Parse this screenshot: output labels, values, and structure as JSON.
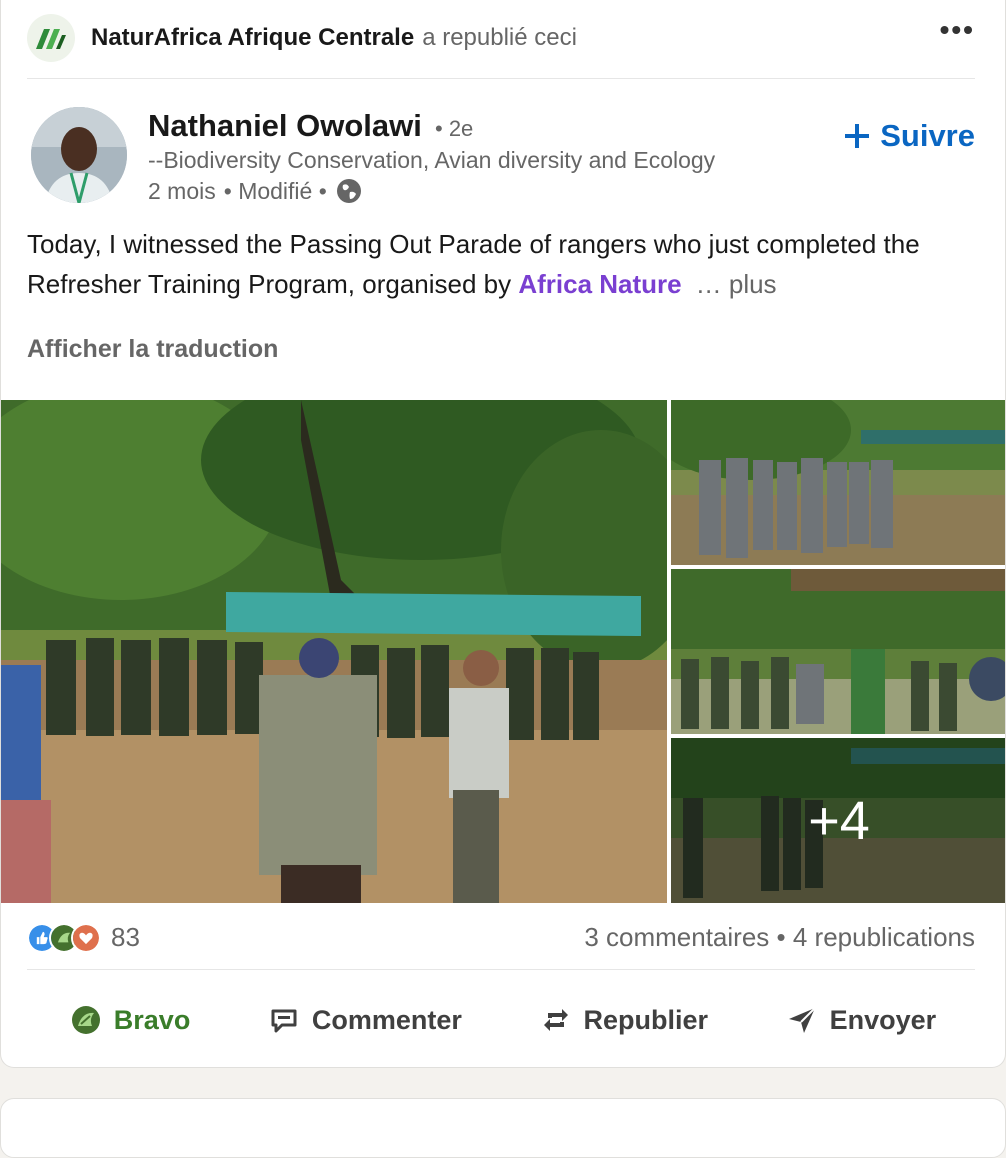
{
  "repost": {
    "org_name": "NaturAfrica Afrique Centrale",
    "action_text": "a republié ceci",
    "more_label": "•••"
  },
  "author": {
    "name": "Nathaniel Owolawi",
    "degree": "• 2e",
    "headline": "--Biodiversity Conservation, Avian diversity and Ecology",
    "time": "2 mois",
    "edited": "• Modifié •",
    "follow_label": "Suivre"
  },
  "post": {
    "text": "Today, I witnessed the Passing Out Parade of rangers who just completed the Refresher Training Program, organised by ",
    "mention": "Africa Nature",
    "see_more": "… plus",
    "translate_label": "Afficher la traduction"
  },
  "media": {
    "more_count": "+4"
  },
  "social": {
    "reaction_count": "83",
    "comments": "3 commentaires",
    "separator": "•",
    "reposts": "4 republications"
  },
  "actions": {
    "bravo": "Bravo",
    "comment": "Commenter",
    "repost": "Republier",
    "send": "Envoyer"
  },
  "colors": {
    "link_blue": "#0a66c2",
    "mention_purple": "#7a3fd1",
    "bravo_green": "#3a7d2a"
  }
}
